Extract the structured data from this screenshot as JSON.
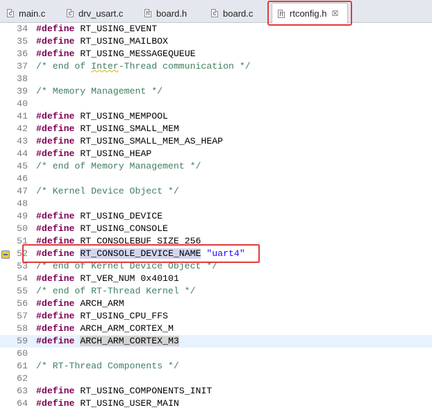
{
  "tabs": [
    {
      "label": "main.c",
      "icon": "c-file-icon",
      "icon_glyph": "c"
    },
    {
      "label": "drv_usart.c",
      "icon": "c-file-icon",
      "icon_glyph": "c"
    },
    {
      "label": "board.h",
      "icon": "h-file-icon",
      "icon_glyph": "h"
    },
    {
      "label": "board.c",
      "icon": "c-file-icon",
      "icon_glyph": "c"
    },
    {
      "label": "rtconfig.h",
      "icon": "h-file-icon",
      "icon_glyph": "h",
      "active": true,
      "close": "☒"
    }
  ],
  "editor": {
    "lines": [
      {
        "num": "34",
        "kw": "#define",
        "text": "RT_USING_EVENT"
      },
      {
        "num": "35",
        "kw": "#define",
        "text": "RT_USING_MAILBOX"
      },
      {
        "num": "36",
        "kw": "#define",
        "text": "RT_USING_MESSAGEQUEUE"
      },
      {
        "num": "37",
        "c1": "/* end of ",
        "c2": "Inter",
        "c3": "-Thread communication */"
      },
      {
        "num": "38"
      },
      {
        "num": "39",
        "comment": "/* Memory Management */"
      },
      {
        "num": "40"
      },
      {
        "num": "41",
        "kw": "#define",
        "text": "RT_USING_MEMPOOL"
      },
      {
        "num": "42",
        "kw": "#define",
        "text": "RT_USING_SMALL_MEM"
      },
      {
        "num": "43",
        "kw": "#define",
        "text": "RT_USING_SMALL_MEM_AS_HEAP"
      },
      {
        "num": "44",
        "kw": "#define",
        "text": "RT_USING_HEAP"
      },
      {
        "num": "45",
        "comment": "/* end of Memory Management */"
      },
      {
        "num": "46"
      },
      {
        "num": "47",
        "comment": "/* Kernel Device Object */"
      },
      {
        "num": "48"
      },
      {
        "num": "49",
        "kw": "#define",
        "text": "RT_USING_DEVICE"
      },
      {
        "num": "50",
        "kw": "#define",
        "text": "RT_USING_CONSOLE"
      },
      {
        "num": "51",
        "kw": "#define",
        "text": "RT_CONSOLEBUF_SIZE 256"
      },
      {
        "num": "52",
        "kw": "#define",
        "ident": "RT_CONSOLE_DEVICE_NAME",
        "str": "\"uart4\""
      },
      {
        "num": "53",
        "comment": "/* end of Kernel Device Object */"
      },
      {
        "num": "54",
        "kw": "#define",
        "text": "RT_VER_NUM 0x40101"
      },
      {
        "num": "55",
        "comment": "/* end of RT-Thread Kernel */"
      },
      {
        "num": "56",
        "kw": "#define",
        "text": "ARCH_ARM"
      },
      {
        "num": "57",
        "kw": "#define",
        "text": "RT_USING_CPU_FFS"
      },
      {
        "num": "58",
        "kw": "#define",
        "text": "ARCH_ARM_CORTEX_M"
      },
      {
        "num": "59",
        "kw": "#define",
        "ident": "ARCH_ARM_CORTEX_M3"
      },
      {
        "num": "60"
      },
      {
        "num": "61",
        "comment": "/* RT-Thread Components */"
      },
      {
        "num": "62"
      },
      {
        "num": "63",
        "kw": "#define",
        "text": "RT_USING_COMPONENTS_INIT"
      },
      {
        "num": "64",
        "kw": "#define",
        "text": "RT_USING_USER_MAIN"
      }
    ]
  }
}
